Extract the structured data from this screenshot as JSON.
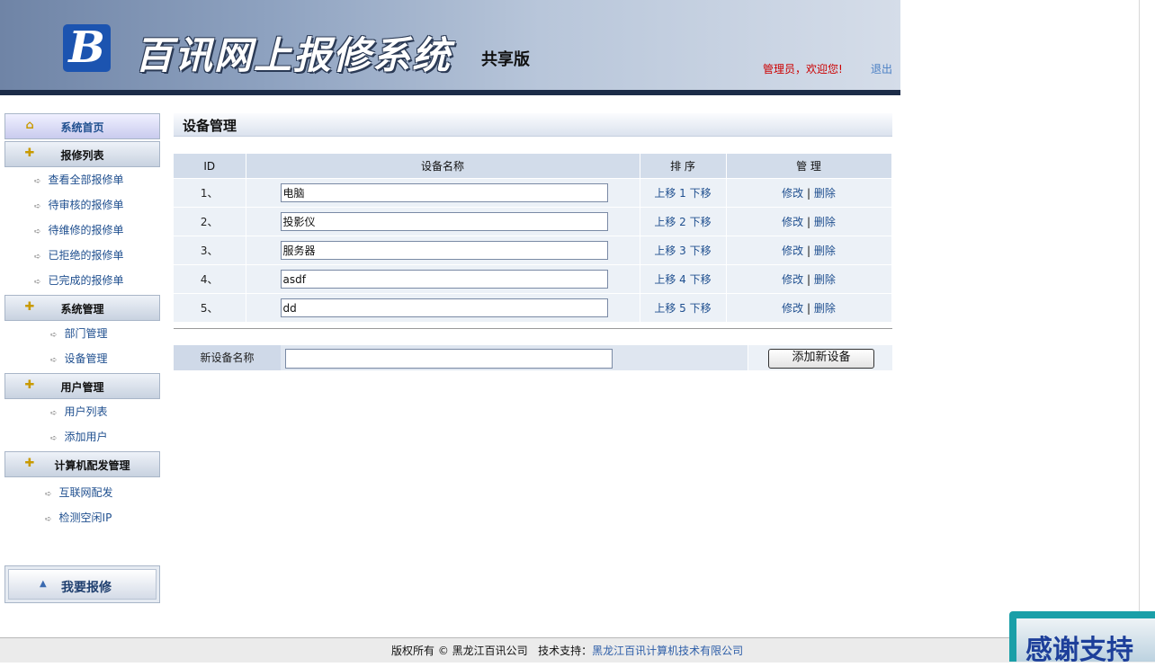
{
  "header": {
    "logo_letter": "B",
    "site_title": "百讯网上报修系统",
    "edition": "共享版",
    "welcome": "管理员，欢迎您!",
    "logout": "退出"
  },
  "sidebar": {
    "home": "系统首页",
    "sections": [
      {
        "title": "报修列表",
        "items": [
          "查看全部报修单",
          "待审核的报修单",
          "待维修的报修单",
          "已拒绝的报修单",
          "已完成的报修单"
        ]
      },
      {
        "title": "系统管理",
        "items": [
          "部门管理",
          "设备管理"
        ]
      },
      {
        "title": "用户管理",
        "items": [
          "用户列表",
          "添加用户"
        ]
      },
      {
        "title": "计算机配发管理",
        "items": [
          "互联网配发",
          "检测空闲IP"
        ]
      }
    ],
    "report_button": "我要报修"
  },
  "main": {
    "title": "设备管理",
    "table": {
      "headers": [
        "ID",
        "设备名称",
        "排 序",
        "管 理"
      ],
      "rows": [
        {
          "id": "1、",
          "name": "电脑",
          "order": "1"
        },
        {
          "id": "2、",
          "name": "投影仪",
          "order": "2"
        },
        {
          "id": "3、",
          "name": "服务器",
          "order": "3"
        },
        {
          "id": "4、",
          "name": "asdf",
          "order": "4"
        },
        {
          "id": "5、",
          "name": "dd",
          "order": "5"
        }
      ],
      "move_up": "上移",
      "move_down": "下移",
      "edit": "修改",
      "separator": "|",
      "delete": "删除"
    },
    "add_form": {
      "label": "新设备名称",
      "value": "",
      "button": "添加新设备"
    }
  },
  "footer": {
    "copyright": "版权所有 © 黑龙江百讯公司",
    "support_label": "技术支持：",
    "support_company": "黑龙江百讯计算机技术有限公司"
  },
  "badge": {
    "text": "感谢支持"
  }
}
